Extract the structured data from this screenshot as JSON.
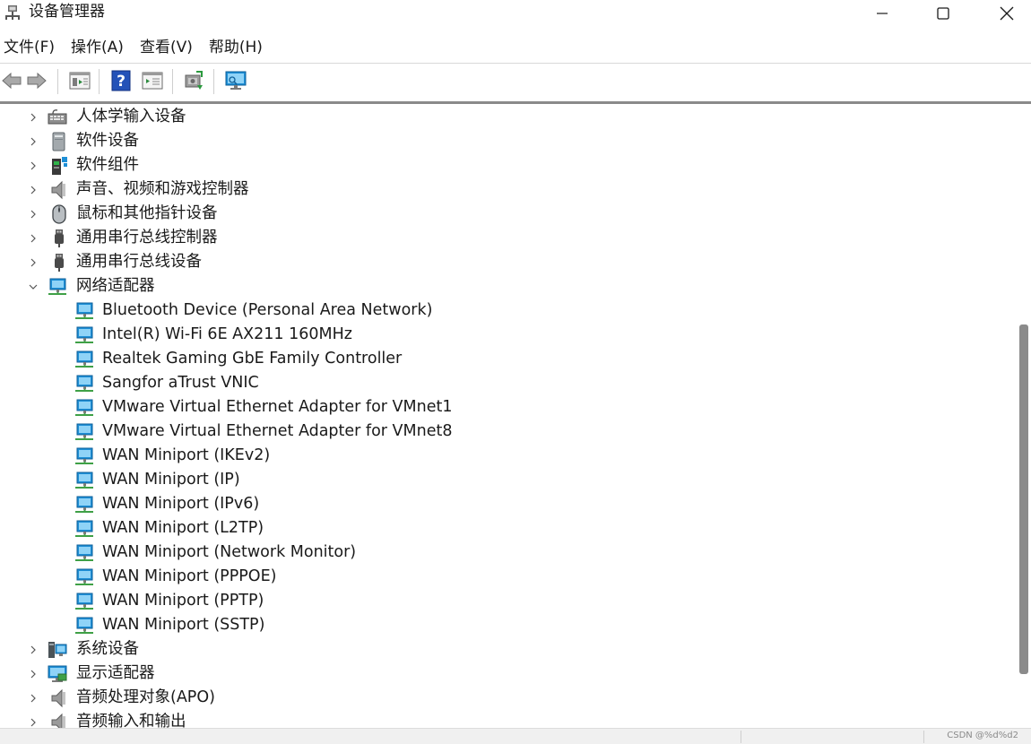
{
  "window": {
    "title": "设备管理器"
  },
  "menu": [
    "文件(F)",
    "操作(A)",
    "查看(V)",
    "帮助(H)"
  ],
  "toolbar": {
    "buttons": [
      "back-arrow-icon",
      "forward-arrow-icon",
      "properties-icon",
      "help-icon",
      "show-hide-icon",
      "update-driver-icon",
      "monitor-scan-icon"
    ]
  },
  "tree": {
    "categories_before": [
      {
        "label": "人体学输入设备",
        "icon": "hid-icon"
      },
      {
        "label": "软件设备",
        "icon": "software-device-icon"
      },
      {
        "label": "软件组件",
        "icon": "software-component-icon"
      },
      {
        "label": "声音、视频和游戏控制器",
        "icon": "speaker-icon"
      },
      {
        "label": "鼠标和其他指针设备",
        "icon": "mouse-icon"
      },
      {
        "label": "通用串行总线控制器",
        "icon": "usb-icon"
      },
      {
        "label": "通用串行总线设备",
        "icon": "usb-icon"
      }
    ],
    "expanded_category": {
      "label": "网络适配器",
      "icon": "network-adapter-icon"
    },
    "adapters": [
      "Bluetooth Device (Personal Area Network)",
      "Intel(R) Wi-Fi 6E AX211 160MHz",
      "Realtek Gaming GbE Family Controller",
      "Sangfor aTrust VNIC",
      "VMware Virtual Ethernet Adapter for VMnet1",
      "VMware Virtual Ethernet Adapter for VMnet8",
      "WAN Miniport (IKEv2)",
      "WAN Miniport (IP)",
      "WAN Miniport (IPv6)",
      "WAN Miniport (L2TP)",
      "WAN Miniport (Network Monitor)",
      "WAN Miniport (PPPOE)",
      "WAN Miniport (PPTP)",
      "WAN Miniport (SSTP)"
    ],
    "categories_after": [
      {
        "label": "系统设备",
        "icon": "system-device-icon"
      },
      {
        "label": "显示适配器",
        "icon": "display-adapter-icon"
      },
      {
        "label": "音频处理对象(APO)",
        "icon": "speaker-icon"
      },
      {
        "label": "音频输入和输出",
        "icon": "speaker-icon"
      }
    ]
  },
  "statusbar": {
    "watermark": "CSDN @%d%d2"
  },
  "colors": {
    "network_blue": "#1e8fd6",
    "cable_green": "#3fa046",
    "scroll_thumb": "#8b8b8b"
  }
}
